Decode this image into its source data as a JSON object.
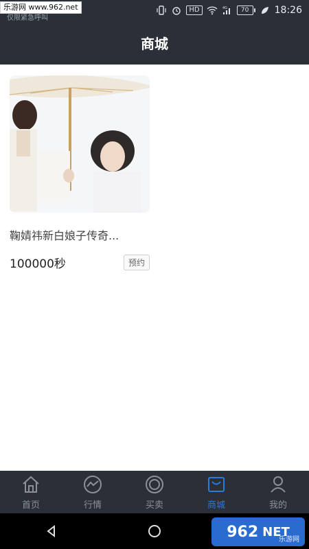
{
  "status_bar": {
    "watermark": "乐游网 www.962.net",
    "carrier": "仅限紧急呼叫",
    "time": "18:26",
    "hd_badge": "HD",
    "network": "4G",
    "battery": "70"
  },
  "header": {
    "title": "商城"
  },
  "product": {
    "title": "鞠婧祎新白娘子传奇...",
    "price": "100000秒",
    "reserve_label": "预约",
    "image_icon": "photo-couple-with-umbrella"
  },
  "bottom_nav": {
    "items": [
      {
        "label": "首页",
        "icon": "home-icon"
      },
      {
        "label": "行情",
        "icon": "trend-icon"
      },
      {
        "label": "买卖",
        "icon": "circle-icon"
      },
      {
        "label": "商城",
        "icon": "mall-icon",
        "active": true
      },
      {
        "label": "我的",
        "icon": "user-icon"
      }
    ],
    "active_color": "#2e7bd6",
    "inactive_color": "#8c9199"
  },
  "system_nav": {
    "back": "back-icon",
    "home": "home-circle-icon"
  },
  "watermark_logo": {
    "num": "962",
    "net": "NET",
    "sub": "乐游网"
  },
  "colors": {
    "header_bg": "#2b2f38",
    "content_bg": "#ffffff"
  }
}
